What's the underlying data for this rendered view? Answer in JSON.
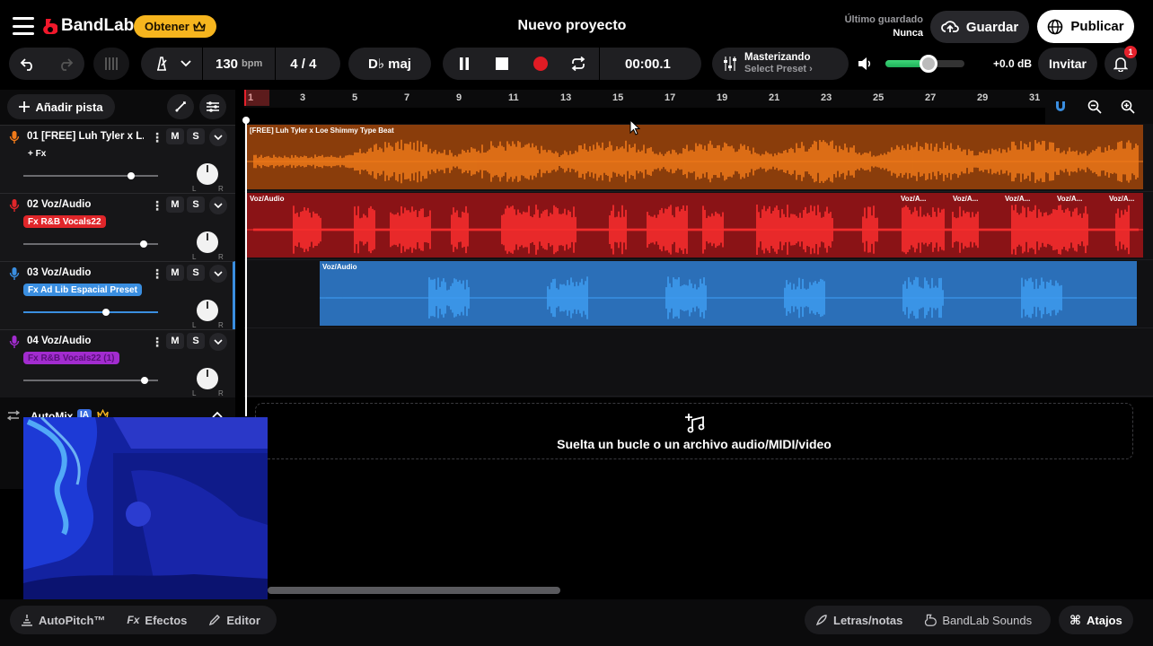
{
  "header": {
    "brand": "BandLab",
    "get_label": "Obtener",
    "project_title": "Nuevo proyecto",
    "last_saved_label": "Último guardado",
    "last_saved_value": "Nunca",
    "save_label": "Guardar",
    "publish_label": "Publicar"
  },
  "toolbar": {
    "tempo_value": "130",
    "tempo_unit": "bpm",
    "time_signature": "4 / 4",
    "key": "D♭ maj",
    "time": "00:00.1",
    "mastering_title": "Masterizando",
    "mastering_preset": "Select Preset ›",
    "volume_db": "+0.0 dB",
    "volume_level": 0.55,
    "invite_label": "Invitar",
    "notifications": "1"
  },
  "tracks_panel": {
    "add_track_label": "Añadir pista",
    "tracks": [
      {
        "name": "01  [FREE] Luh Tyler x L...",
        "fx": "+ Fx",
        "color": "#f07a1a",
        "fx_bg": "transparent",
        "fx_fg": "#ffffff",
        "volume": 0.8,
        "mute": "M",
        "solo": "S"
      },
      {
        "name": "02  Voz/Audio",
        "fx": "Fx R&B Vocals22",
        "color": "#e0262a",
        "fx_bg": "#e0262a",
        "fx_fg": "#ffffff",
        "volume": 0.89,
        "mute": "M",
        "solo": "S"
      },
      {
        "name": "03  Voz/Audio",
        "fx": "Fx Ad Lib Espacial Preset",
        "color": "#3a8ee0",
        "fx_bg": "#3a8ee0",
        "fx_fg": "#ffffff",
        "volume": 0.61,
        "mute": "M",
        "solo": "S"
      },
      {
        "name": "04  Voz/Audio",
        "fx": "Fx R&B Vocals22 (1)",
        "color": "#a22ccf",
        "fx_bg": "#a22ccf",
        "fx_fg": "#5a107a",
        "volume": 0.9,
        "mute": "M",
        "solo": "S"
      }
    ],
    "pan_left": "L",
    "pan_right": "R",
    "automix_label": "AutoMix",
    "automix_badge": "IA"
  },
  "timeline": {
    "ruler_ticks": [
      "1",
      "3",
      "5",
      "7",
      "9",
      "11",
      "13",
      "15",
      "17",
      "19",
      "21",
      "23",
      "25",
      "27",
      "29",
      "31"
    ],
    "clips": [
      {
        "label": "[FREE] Luh Tyler x Loe Shimmy Type Beat",
        "color": "#f07a1a",
        "bg": "#8a3d0b"
      },
      {
        "label": "Voz/Audio",
        "color": "#ff2f2f",
        "bg": "#8a1316",
        "extra_labels": [
          "Voz/A...",
          "Voz/A...",
          "Voz/A...",
          "Voz/A...",
          "Voz/A..."
        ]
      },
      {
        "label": "Voz/Audio",
        "color": "#3f9df2",
        "bg": "#2b6fb8"
      }
    ],
    "dropzone_text": "Suelta un bucle o un archivo audio/MIDI/video"
  },
  "bottombar": {
    "autopitch": "AutoPitch™",
    "effects": "Efectos",
    "editor": "Editor",
    "lyrics": "Letras/notas",
    "sounds": "BandLab Sounds",
    "shortcuts": "Atajos"
  }
}
